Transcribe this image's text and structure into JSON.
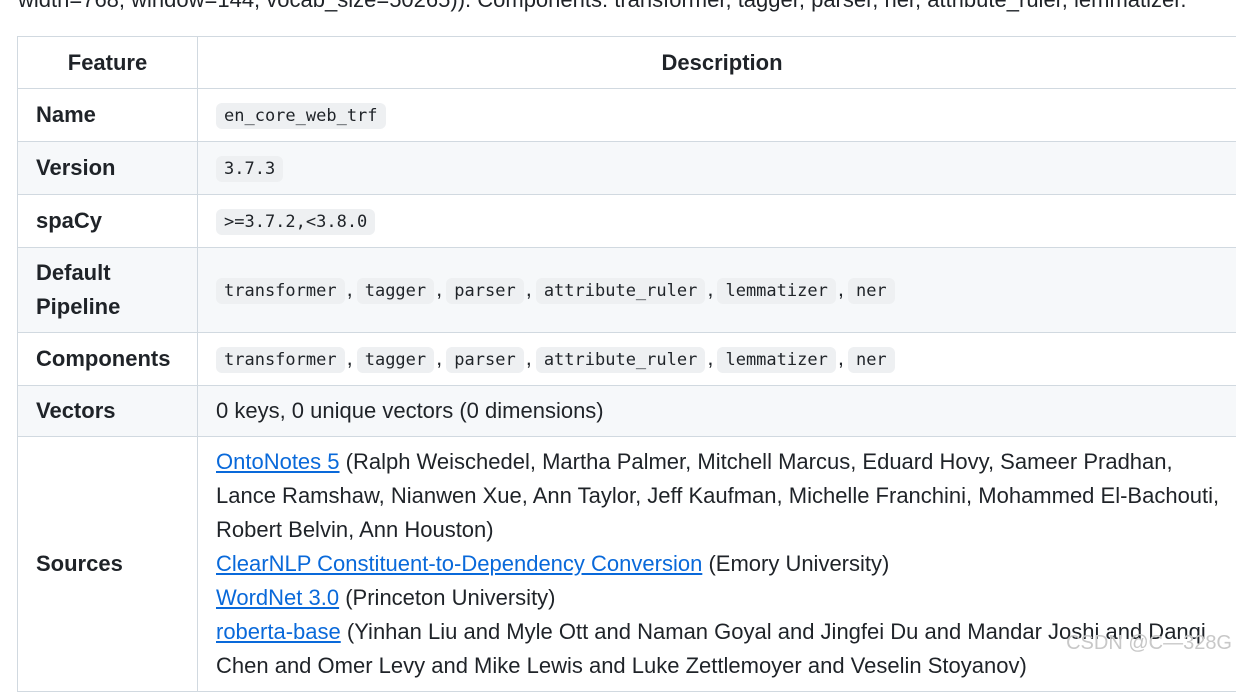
{
  "top_text": "width=768, window=144, vocab_size=50265)). Components: transformer, tagger, parser, ner, attribute_ruler, lemmatizer.",
  "table": {
    "headers": [
      "Feature",
      "Description"
    ],
    "name": {
      "label": "Name",
      "value": "en_core_web_trf"
    },
    "version": {
      "label": "Version",
      "value": "3.7.3"
    },
    "spacy": {
      "label": "spaCy",
      "value": ">=3.7.2,<3.8.0"
    },
    "pipeline": {
      "label": "Default Pipeline",
      "items": [
        "transformer",
        "tagger",
        "parser",
        "attribute_ruler",
        "lemmatizer",
        "ner"
      ]
    },
    "components": {
      "label": "Components",
      "items": [
        "transformer",
        "tagger",
        "parser",
        "attribute_ruler",
        "lemmatizer",
        "ner"
      ]
    },
    "vectors": {
      "label": "Vectors",
      "value": "0 keys, 0 unique vectors (0 dimensions)"
    },
    "sources": {
      "label": "Sources",
      "entries": [
        {
          "link": "OntoNotes 5",
          "line1": "(Ralph Weischedel, Martha Palmer, Mitchell Marcus, Eduard Hovy, Sameer Pradhan,",
          "line2": "Lance Ramshaw, Nianwen Xue, Ann Taylor, Jeff Kaufman, Michelle Franchini, Mohammed El-Bachouti,",
          "line3": "Robert Belvin, Ann Houston)"
        },
        {
          "link": "ClearNLP Constituent-to-Dependency Conversion",
          "line1": "(Emory University)"
        },
        {
          "link": "WordNet 3.0",
          "line1": "(Princeton University)"
        },
        {
          "link": "roberta-base",
          "line1": "(Yinhan Liu and Myle Ott and Naman Goyal and Jingfei Du and Mandar Joshi and Danqi",
          "line2": "Chen and Omer Levy and Mike Lewis and Luke Zettlemoyer and Veselin Stoyanov)"
        }
      ]
    }
  },
  "separator": ",",
  "watermark": "CSDN @C—328G"
}
